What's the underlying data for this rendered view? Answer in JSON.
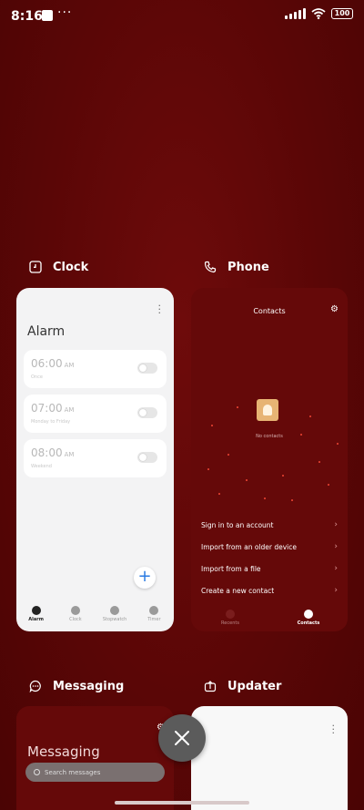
{
  "status_bar": {
    "time": "8:16",
    "dots": "···",
    "battery": "100"
  },
  "apps": {
    "clock": {
      "label": "Clock",
      "card": {
        "title": "Alarm",
        "alarms": [
          {
            "time": "06:00",
            "ampm": "AM",
            "sub": "Once"
          },
          {
            "time": "07:00",
            "ampm": "AM",
            "sub": "Monday to Friday"
          },
          {
            "time": "08:00",
            "ampm": "AM",
            "sub": "Weekend"
          }
        ],
        "nav": [
          "Alarm",
          "Clock",
          "Stopwatch",
          "Timer"
        ]
      }
    },
    "phone": {
      "label": "Phone",
      "card": {
        "title": "Contacts",
        "empty_text": "No contacts",
        "links": [
          "Sign in to an account",
          "Import from an older device",
          "Import from a file",
          "Create a new contact"
        ],
        "nav": [
          "Recents",
          "Contacts"
        ]
      }
    },
    "messaging": {
      "label": "Messaging",
      "card": {
        "title": "Messaging",
        "search_placeholder": "Search messages"
      }
    },
    "updater": {
      "label": "Updater"
    }
  },
  "icons": {
    "close": "close-icon",
    "settings": "gear-icon",
    "more": "more-vertical-icon"
  },
  "colors": {
    "background": "#5a0606",
    "accent": "#2a7ae2"
  }
}
